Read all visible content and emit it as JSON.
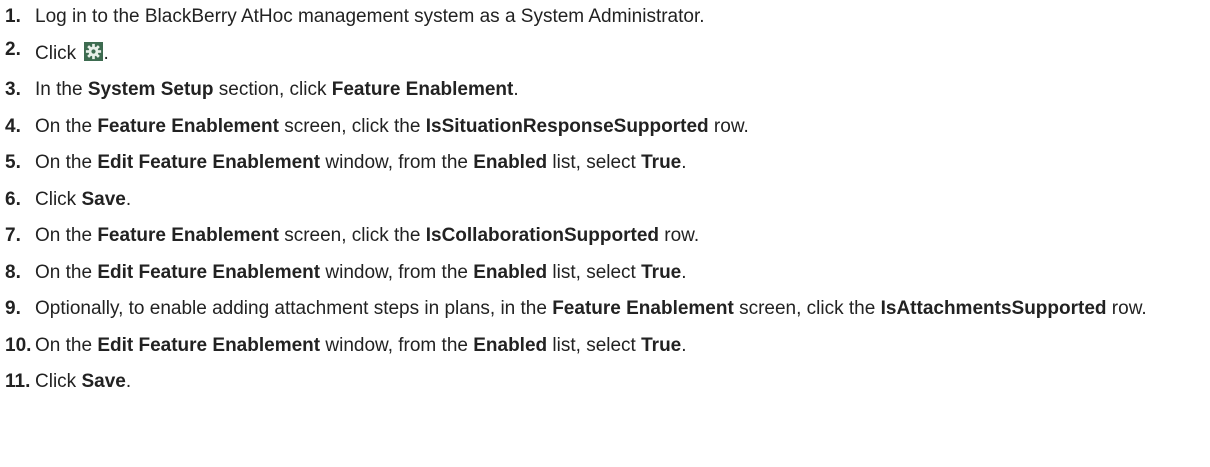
{
  "steps": [
    {
      "num": "1.",
      "parts": [
        {
          "t": "Log in to the BlackBerry AtHoc management system as a System Administrator."
        }
      ]
    },
    {
      "num": "2.",
      "parts": [
        {
          "t": "Click "
        },
        {
          "icon": "gear-icon"
        },
        {
          "t": "."
        }
      ]
    },
    {
      "num": "3.",
      "parts": [
        {
          "t": "In the "
        },
        {
          "b": "System Setup"
        },
        {
          "t": " section, click "
        },
        {
          "b": "Feature Enablement"
        },
        {
          "t": "."
        }
      ]
    },
    {
      "num": "4.",
      "parts": [
        {
          "t": "On the "
        },
        {
          "b": "Feature Enablement"
        },
        {
          "t": " screen, click the "
        },
        {
          "b": "IsSituationResponseSupported"
        },
        {
          "t": " row."
        }
      ]
    },
    {
      "num": "5.",
      "parts": [
        {
          "t": "On the "
        },
        {
          "b": "Edit Feature Enablement"
        },
        {
          "t": " window, from the "
        },
        {
          "b": "Enabled"
        },
        {
          "t": " list, select "
        },
        {
          "b": "True"
        },
        {
          "t": "."
        }
      ]
    },
    {
      "num": "6.",
      "parts": [
        {
          "t": "Click "
        },
        {
          "b": "Save"
        },
        {
          "t": "."
        }
      ]
    },
    {
      "num": "7.",
      "parts": [
        {
          "t": "On the "
        },
        {
          "b": "Feature Enablement"
        },
        {
          "t": " screen, click the "
        },
        {
          "b": "IsCollaborationSupported"
        },
        {
          "t": " row."
        }
      ]
    },
    {
      "num": "8.",
      "parts": [
        {
          "t": "On the "
        },
        {
          "b": "Edit Feature Enablement"
        },
        {
          "t": " window, from the "
        },
        {
          "b": "Enabled"
        },
        {
          "t": " list, select "
        },
        {
          "b": "True"
        },
        {
          "t": "."
        }
      ]
    },
    {
      "num": "9.",
      "parts": [
        {
          "t": "Optionally, to enable adding attachment steps in plans, in the "
        },
        {
          "b": "Feature Enablement"
        },
        {
          "t": " screen, click the "
        },
        {
          "b": "IsAttachmentsSupported"
        },
        {
          "t": " row."
        }
      ]
    },
    {
      "num": "10.",
      "parts": [
        {
          "t": "On the "
        },
        {
          "b": "Edit Feature Enablement"
        },
        {
          "t": " window, from the "
        },
        {
          "b": "Enabled"
        },
        {
          "t": " list, select "
        },
        {
          "b": "True"
        },
        {
          "t": "."
        }
      ]
    },
    {
      "num": "11.",
      "parts": [
        {
          "t": "Click "
        },
        {
          "b": "Save"
        },
        {
          "t": "."
        }
      ]
    }
  ]
}
